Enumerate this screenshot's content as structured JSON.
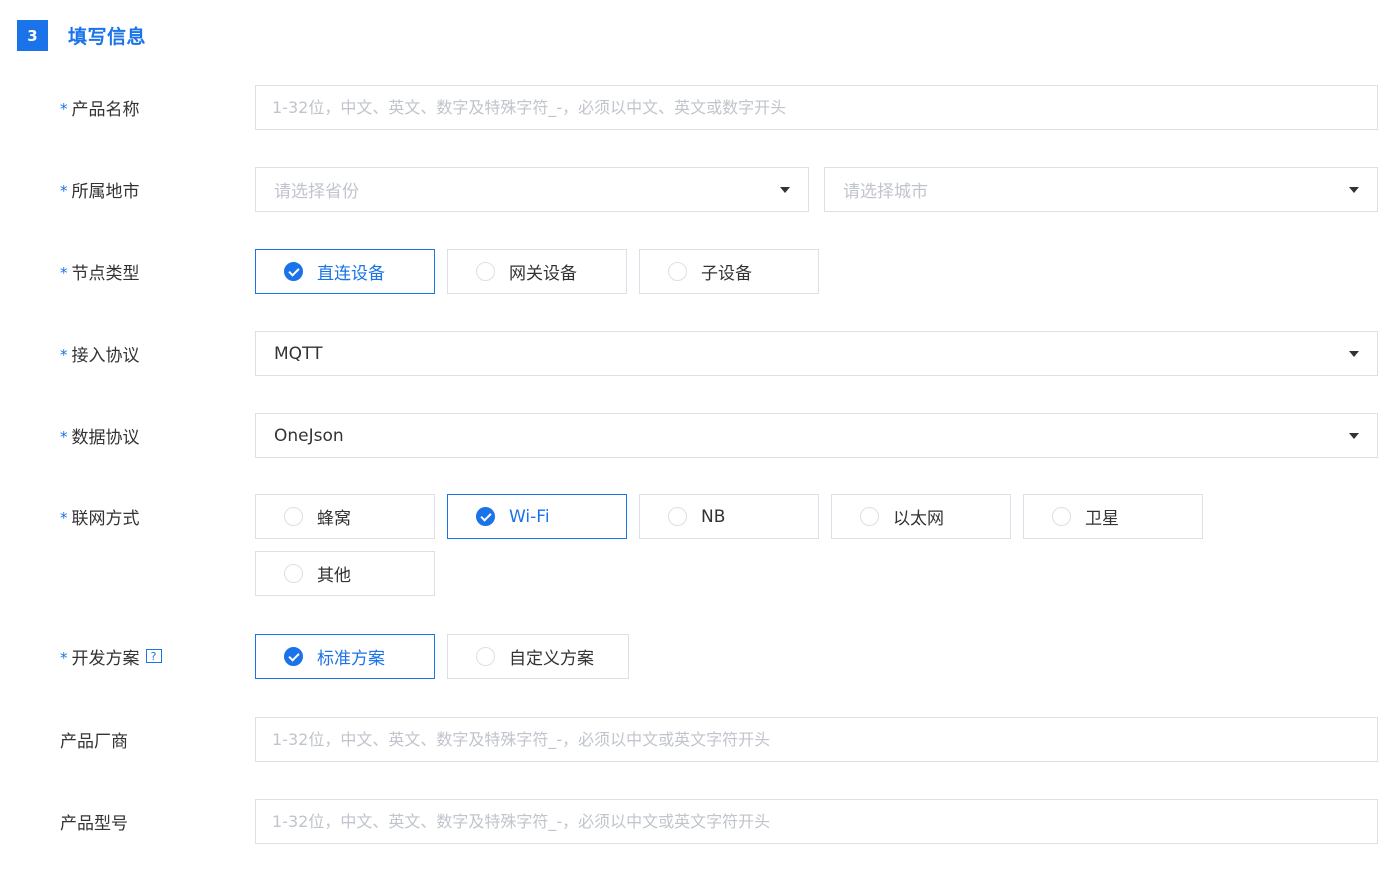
{
  "section": {
    "step": "3",
    "title": "填写信息"
  },
  "required_mark": "*",
  "product_name": {
    "label": "产品名称",
    "placeholder": "1-32位，中文、英文、数字及特殊字符_-，必须以中文、英文或数字开头"
  },
  "location": {
    "label": "所属地市",
    "province_placeholder": "请选择省份",
    "city_placeholder": "请选择城市"
  },
  "node_type": {
    "label": "节点类型",
    "options": [
      "直连设备",
      "网关设备",
      "子设备"
    ],
    "selected": "直连设备"
  },
  "access_protocol": {
    "label": "接入协议",
    "value": "MQTT"
  },
  "data_protocol": {
    "label": "数据协议",
    "value": "OneJson"
  },
  "network": {
    "label": "联网方式",
    "options": [
      "蜂窝",
      "Wi-Fi",
      "NB",
      "以太网",
      "卫星",
      "其他"
    ],
    "selected": "Wi-Fi"
  },
  "dev_scheme": {
    "label": "开发方案",
    "help": "?",
    "options": [
      "标准方案",
      "自定义方案"
    ],
    "selected": "标准方案"
  },
  "vendor": {
    "label": "产品厂商",
    "placeholder": "1-32位，中文、英文、数字及特殊字符_-，必须以中文或英文字符开头"
  },
  "model": {
    "label": "产品型号",
    "placeholder": "1-32位，中文、英文、数字及特殊字符_-，必须以中文或英文字符开头"
  },
  "colors": {
    "accent": "#1a73e8",
    "border": "#dcdfe6",
    "placeholder": "#c0c4cc"
  },
  "icons": {
    "select": "caret-down-icon",
    "radio_checked": "checkmark-icon",
    "help": "question-icon"
  }
}
